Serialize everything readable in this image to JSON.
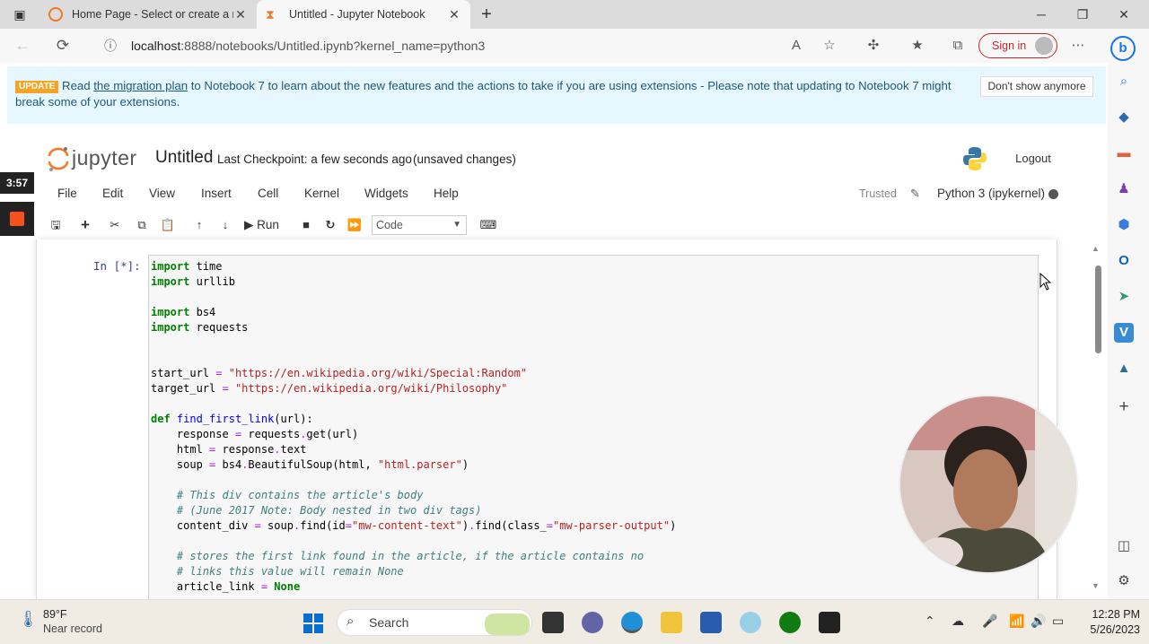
{
  "browser": {
    "tabs": [
      {
        "title": "Home Page - Select or create a n",
        "active": false
      },
      {
        "title": "Untitled - Jupyter Notebook",
        "active": true
      }
    ],
    "url_host": "localhost",
    "url_rest": ":8888/notebooks/Untitled.ipynb?kernel_name=python3",
    "sign_in": "Sign in"
  },
  "banner": {
    "badge": "UPDATE",
    "text_before": "Read ",
    "link": "the migration plan",
    "text_after": " to Notebook 7 to learn about the new features and the actions to take if you are using extensions - Please note that updating to Notebook 7 might break some of your extensions.",
    "dismiss": "Don't show anymore"
  },
  "jupyter": {
    "logo_text": "jupyter",
    "notebook_title": "Untitled",
    "checkpoint": "Last Checkpoint: a few seconds ago",
    "status": "(unsaved changes)",
    "logout": "Logout",
    "menu": [
      "File",
      "Edit",
      "View",
      "Insert",
      "Cell",
      "Kernel",
      "Widgets",
      "Help"
    ],
    "trusted": "Trusted",
    "kernel": "Python 3 (ipykernel)",
    "toolbar": {
      "run": "Run",
      "cell_type": "Code"
    }
  },
  "cell": {
    "prompt": "In [*]:",
    "lines": [
      "import time",
      "import urllib",
      "",
      "import bs4",
      "import requests",
      "",
      "",
      "start_url = \"https://en.wikipedia.org/wiki/Special:Random\"",
      "target_url = \"https://en.wikipedia.org/wiki/Philosophy\"",
      "",
      "def find_first_link(url):",
      "    response = requests.get(url)",
      "    html = response.text",
      "    soup = bs4.BeautifulSoup(html, \"html.parser\")",
      "",
      "    # This div contains the article's body",
      "    # (June 2017 Note: Body nested in two div tags)",
      "    content_div = soup.find(id=\"mw-content-text\").find(class_=\"mw-parser-output\")",
      "",
      "    # stores the first link found in the article, if the article contains no",
      "    # links this value will remain None",
      "    article_link = None"
    ]
  },
  "recorder": {
    "timer": "3:57"
  },
  "taskbar": {
    "temperature": "89°F",
    "weather": "Near record",
    "search": "Search",
    "time": "12:28 PM",
    "date": "5/26/2023"
  }
}
